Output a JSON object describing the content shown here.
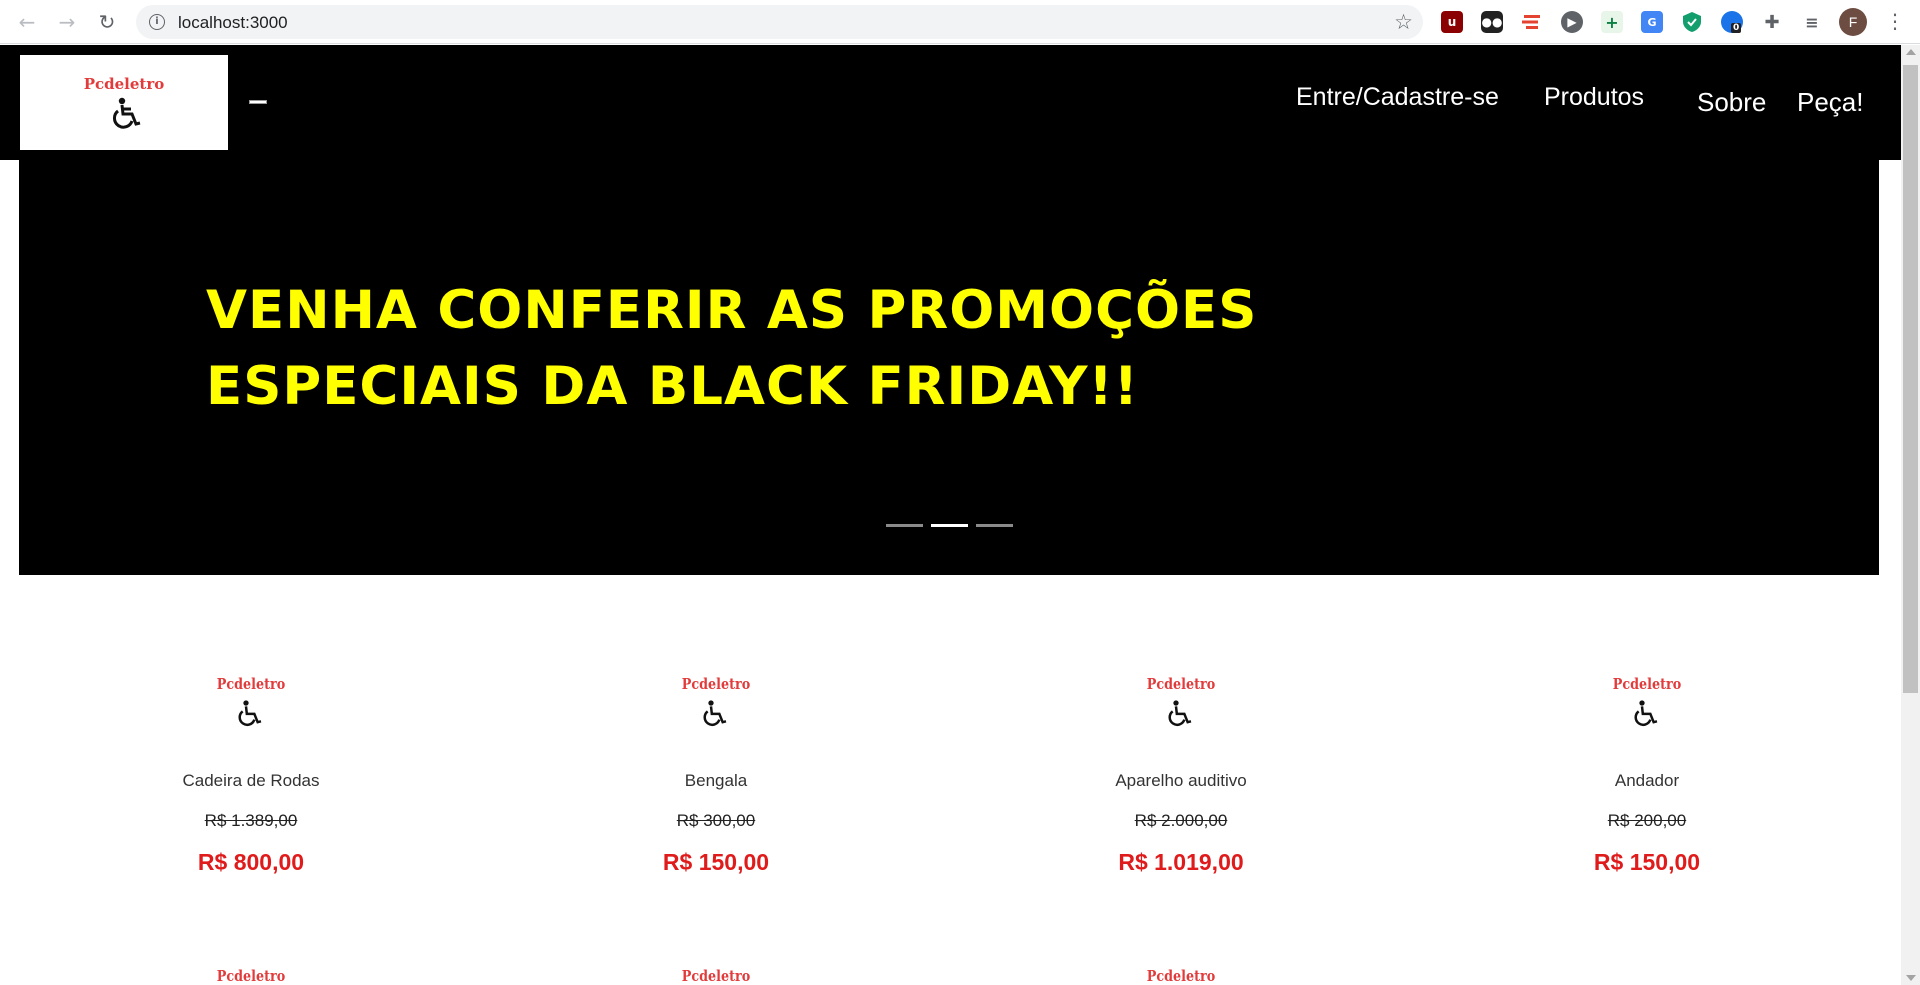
{
  "browser": {
    "url": "localhost:3000",
    "avatar_letter": "F",
    "extension_badge": "0",
    "extensions": [
      "ublock-icon",
      "tampermonkey-icon",
      "todoist-icon",
      "media-play-icon",
      "plus-extension-icon",
      "translate-icon",
      "shield-check-icon",
      "notification-extension-icon",
      "puzzle-icon",
      "reading-list-icon"
    ]
  },
  "header": {
    "brand": "Pcdeletro",
    "nav": {
      "login": "Entre/Cadastre-se",
      "products": "Produtos",
      "about": "Sobre",
      "order": "Peça!"
    }
  },
  "hero": {
    "line1": "VENHA CONFERIR AS PROMOÇÕES",
    "line2": "ESPECIAIS DA BLACK FRIDAY!!",
    "indicators": 3,
    "active_indicator": 2,
    "text_color": "#ffff00"
  },
  "products": [
    {
      "name": "Cadeira de Rodas",
      "old_price": "R$ 1.389,00",
      "price": "R$ 800,00",
      "logo": "Pcdeletro"
    },
    {
      "name": "Bengala",
      "old_price": "R$ 300,00",
      "price": "R$ 150,00",
      "logo": "Pcdeletro"
    },
    {
      "name": "Aparelho auditivo",
      "old_price": "R$ 2.000,00",
      "price": "R$ 1.019,00",
      "logo": "Pcdeletro"
    },
    {
      "name": "Andador",
      "old_price": "R$ 200,00",
      "price": "R$ 150,00",
      "logo": "Pcdeletro"
    }
  ],
  "row2_logos": [
    "Pcdeletro",
    "Pcdeletro",
    "Pcdeletro"
  ],
  "colors": {
    "price": "#e01b1b",
    "brand": "#e23b3b",
    "header_bg": "#000000"
  }
}
